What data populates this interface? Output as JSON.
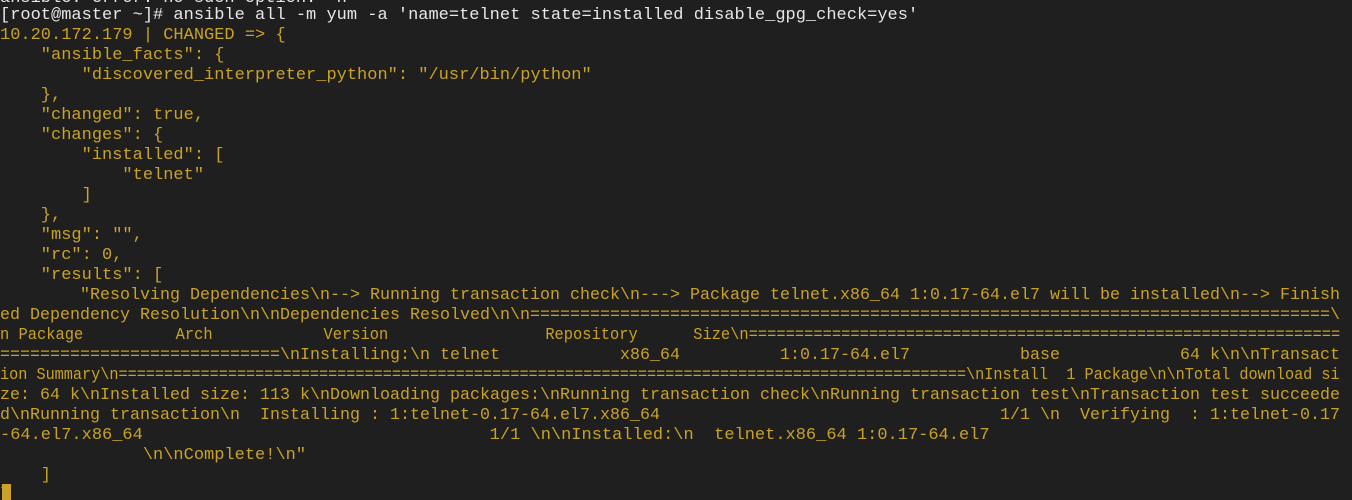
{
  "terminal": {
    "colors": {
      "background": "#1f1f1f",
      "prompt_text": "#e6e6e6",
      "output_text": "#c9a227"
    },
    "lines": [
      "ansible: error: no such option: -n",
      "[root@master ~]# ansible all -m yum -a 'name=telnet state=installed disable_gpg_check=yes'",
      "10.20.172.179 | CHANGED => {",
      "    \"ansible_facts\": {",
      "        \"discovered_interpreter_python\": \"/usr/bin/python\"",
      "    },",
      "    \"changed\": true,",
      "    \"changes\": {",
      "        \"installed\": [",
      "            \"telnet\"",
      "        ]",
      "    },",
      "    \"msg\": \"\",",
      "    \"rc\": 0,",
      "    \"results\": [",
      "        \"Resolving Dependencies\\n--> Running transaction check\\n---> Package telnet.x86_64 1:0.17-64.el7 will be installed\\n--> Finish",
      "ed Dependency Resolution\\n\\nDependencies Resolved\\n\\n================================================================================\\",
      "n Package          Arch            Version                 Repository      Size\\n================================================================",
      "============================\\nInstalling:\\n telnet            x86_64          1:0.17-64.el7           base            64 k\\n\\nTransact",
      "ion Summary\\n=============================================================================================\\nInstall  1 Package\\n\\nTotal download si",
      "ze: 64 k\\nInstalled size: 113 k\\nDownloading packages:\\nRunning transaction check\\nRunning transaction test\\nTransaction test succeede",
      "d\\nRunning transaction\\n  Installing : 1:telnet-0.17-64.el7.x86_64                                  1/1 \\n  Verifying  : 1:telnet-0.17",
      "-64.el7.x86_64                                  1/1 \\n\\nInstalled:\\n  telnet.x86_64 1:0.17-64.el7",
      "              \\n\\nComplete!\\n\"",
      "    ]",
      "}"
    ]
  }
}
